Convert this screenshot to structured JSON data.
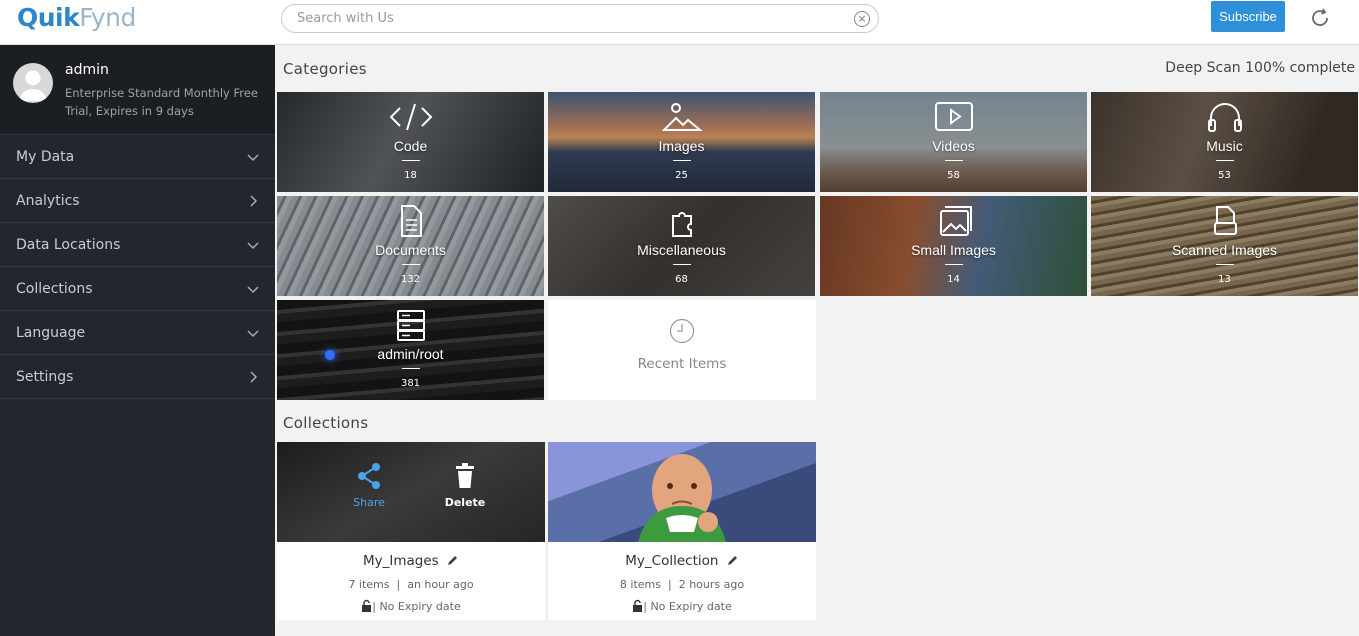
{
  "app": {
    "logo_a": "Quik",
    "logo_b": "Fynd"
  },
  "search": {
    "placeholder": "Search with Us"
  },
  "header": {
    "subscribe": "Subscribe"
  },
  "user": {
    "name": "admin",
    "plan": "Enterprise Standard Monthly Free Trial, Expires in 9 days"
  },
  "nav": [
    {
      "label": "My Data"
    },
    {
      "label": "Analytics"
    },
    {
      "label": "Data Locations"
    },
    {
      "label": "Collections"
    },
    {
      "label": "Language"
    },
    {
      "label": "Settings"
    }
  ],
  "main": {
    "categories_title": "Categories",
    "scan_status": "Deep Scan 100% complete",
    "collections_title": "Collections",
    "recent_label": "Recent Items"
  },
  "categories": [
    {
      "label": "Code",
      "count": "18",
      "icon": "code-icon"
    },
    {
      "label": "Images",
      "count": "25",
      "icon": "image-icon"
    },
    {
      "label": "Videos",
      "count": "58",
      "icon": "video-icon"
    },
    {
      "label": "Music",
      "count": "53",
      "icon": "headphones-icon"
    },
    {
      "label": "Documents",
      "count": "132",
      "icon": "document-icon"
    },
    {
      "label": "Miscellaneous",
      "count": "68",
      "icon": "puzzle-icon"
    },
    {
      "label": "Small Images",
      "count": "14",
      "icon": "gallery-icon"
    },
    {
      "label": "Scanned Images",
      "count": "13",
      "icon": "scan-icon"
    },
    {
      "label": "admin/root",
      "count": "381",
      "icon": "server-icon"
    }
  ],
  "collections": [
    {
      "name": "My_Images",
      "items": "7 items",
      "time": "an hour ago",
      "expiry": "No Expiry date",
      "share": "Share",
      "delete": "Delete"
    },
    {
      "name": "My_Collection",
      "items": "8 items",
      "time": "2 hours ago",
      "expiry": "No Expiry date"
    }
  ],
  "colors": {
    "accent": "#2f8fd8",
    "sidebar": "#22272e"
  }
}
